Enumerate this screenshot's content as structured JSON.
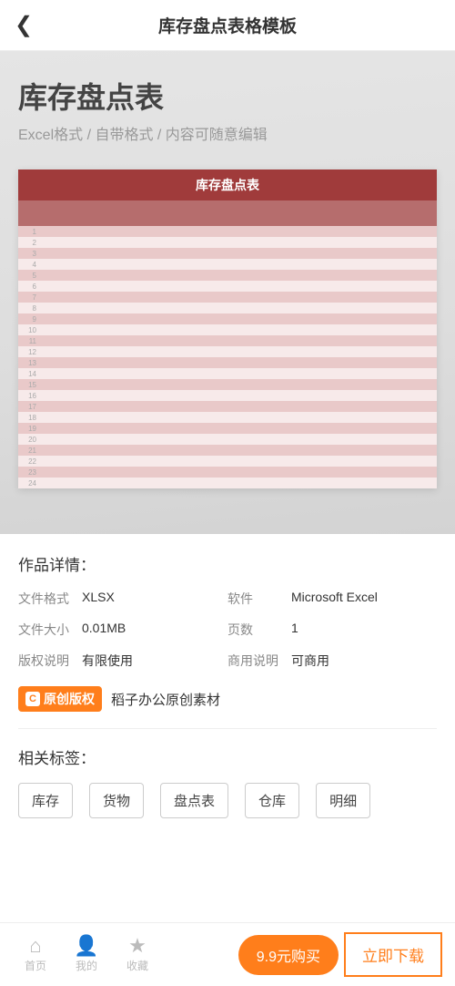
{
  "header": {
    "title": "库存盘点表格模板"
  },
  "preview": {
    "title": "库存盘点表",
    "subtitle": "Excel格式 / 自带格式 / 内容可随意编辑",
    "sheet_title": "库存盘点表",
    "row_count": 24
  },
  "details": {
    "section_title": "作品详情：",
    "rows": {
      "format_label": "文件格式",
      "format_value": "XLSX",
      "software_label": "软件",
      "software_value": "Microsoft Excel",
      "size_label": "文件大小",
      "size_value": "0.01MB",
      "pages_label": "页数",
      "pages_value": "1",
      "copyright_label": "版权说明",
      "copyright_value": "有限使用",
      "commercial_label": "商用说明",
      "commercial_value": "可商用"
    },
    "original_badge": "原创版权",
    "original_text": "稻子办公原创素材"
  },
  "tags": {
    "section_title": "相关标签：",
    "items": [
      "库存",
      "货物",
      "盘点表",
      "仓库",
      "明细"
    ]
  },
  "bottom": {
    "home": "首页",
    "mine": "我的",
    "fav": "收藏",
    "buy": "9.9元购买",
    "download": "立即下载"
  }
}
